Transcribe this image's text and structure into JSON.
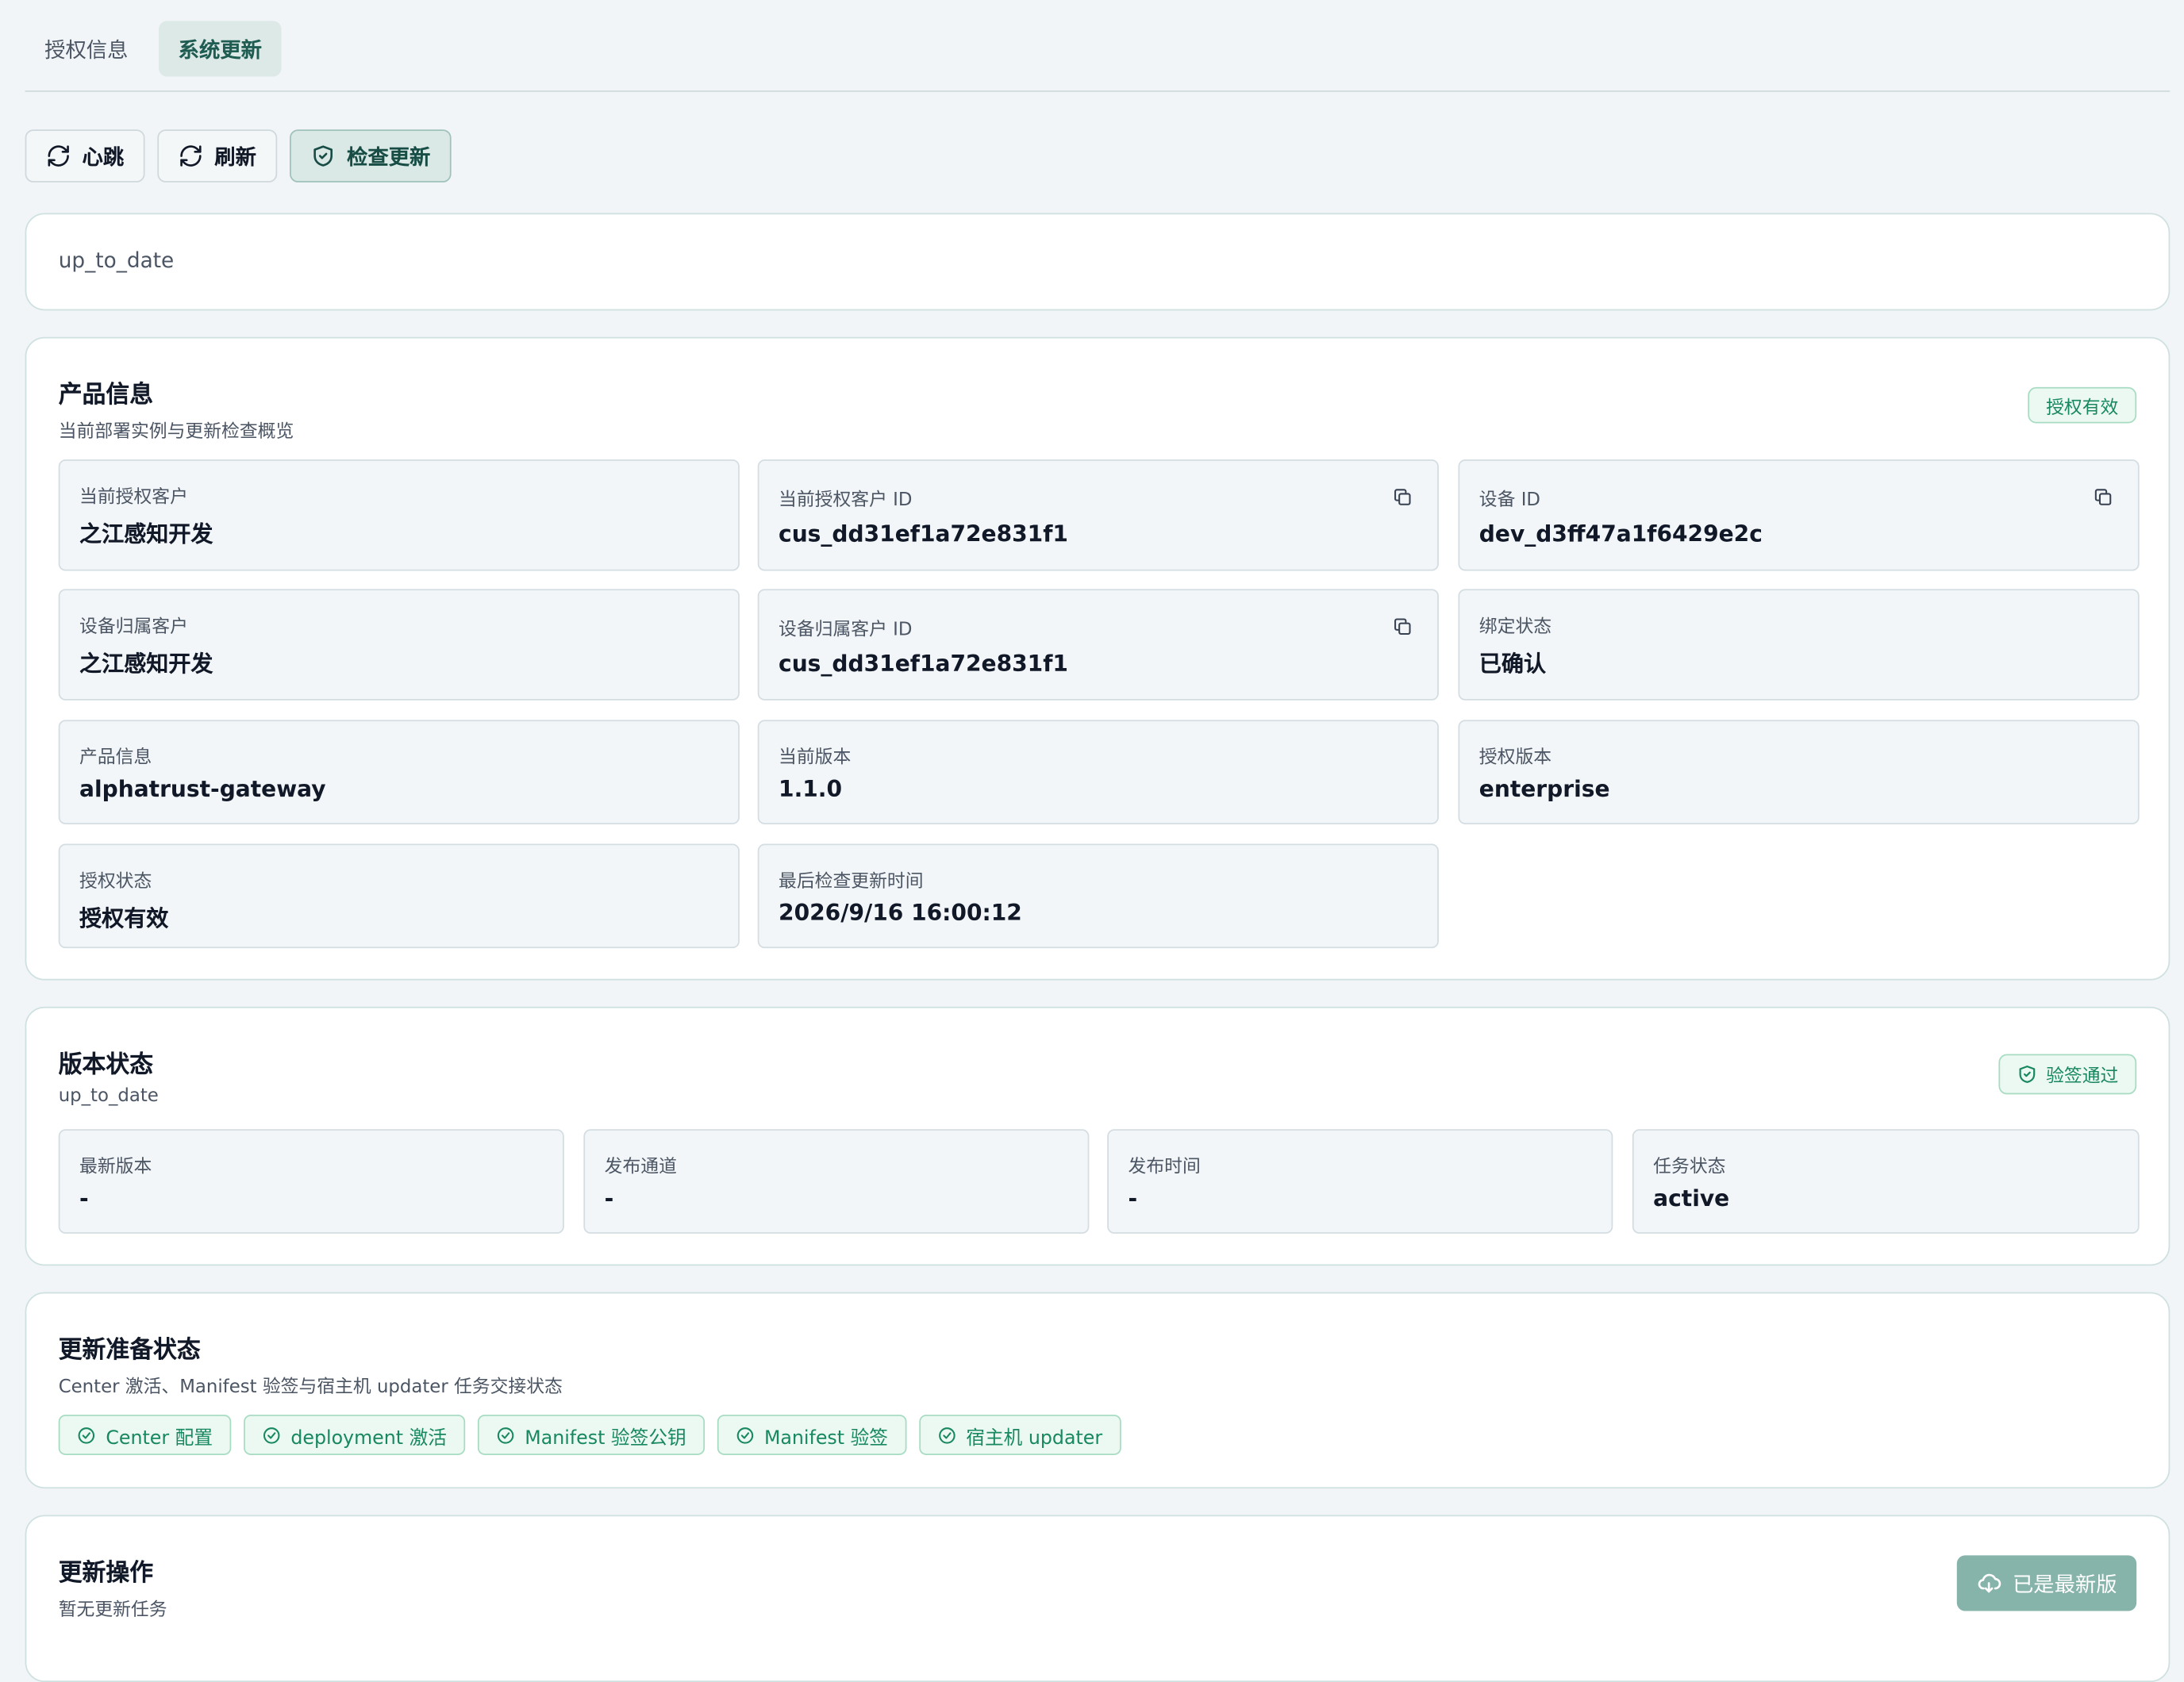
{
  "tabs": [
    {
      "label": "授权信息",
      "active": false
    },
    {
      "label": "系统更新",
      "active": true
    }
  ],
  "toolbar": {
    "heartbeat": "心跳",
    "refresh": "刷新",
    "check_update": "检查更新"
  },
  "status_banner": {
    "text": "up_to_date"
  },
  "product_info": {
    "title": "产品信息",
    "subtitle": "当前部署实例与更新检查概览",
    "badge": "授权有效",
    "fields": [
      {
        "label": "当前授权客户",
        "value": "之江感知开发"
      },
      {
        "label": "当前授权客户 ID",
        "value": "cus_dd31ef1a72e831f1"
      },
      {
        "label": "设备 ID",
        "value": "dev_d3ff47a1f6429e2c"
      },
      {
        "label": "设备归属客户",
        "value": "之江感知开发"
      },
      {
        "label": "设备归属客户 ID",
        "value": "cus_dd31ef1a72e831f1"
      },
      {
        "label": "绑定状态",
        "value": "已确认"
      },
      {
        "label": "产品信息",
        "value": "alphatrust-gateway"
      },
      {
        "label": "当前版本",
        "value": "1.1.0"
      },
      {
        "label": "授权版本",
        "value": "enterprise"
      },
      {
        "label": "授权状态",
        "value": "授权有效"
      },
      {
        "label": "最后检查更新时间",
        "value": "2026/9/16 16:00:12"
      }
    ]
  },
  "version_status": {
    "title": "版本状态",
    "subtitle": "up_to_date",
    "badge": "验签通过",
    "fields": [
      {
        "label": "最新版本",
        "value": "-"
      },
      {
        "label": "发布通道",
        "value": "-"
      },
      {
        "label": "发布时间",
        "value": "-"
      },
      {
        "label": "任务状态",
        "value": "active"
      }
    ]
  },
  "readiness": {
    "title": "更新准备状态",
    "subtitle": "Center 激活、Manifest 验签与宿主机 updater 任务交接状态",
    "chips": [
      "Center 配置",
      "deployment 激活",
      "Manifest 验签公钥",
      "Manifest 验签",
      "宿主机 updater"
    ]
  },
  "update_ops": {
    "title": "更新操作",
    "subtitle": "暂无更新任务",
    "button": "已是最新版"
  },
  "colors": {
    "accent": "#1f5c52",
    "success": "#17885f",
    "success_bg": "#ecf8f2",
    "page_bg": "#f1f5f7",
    "field_bg": "#f3f6f8"
  }
}
